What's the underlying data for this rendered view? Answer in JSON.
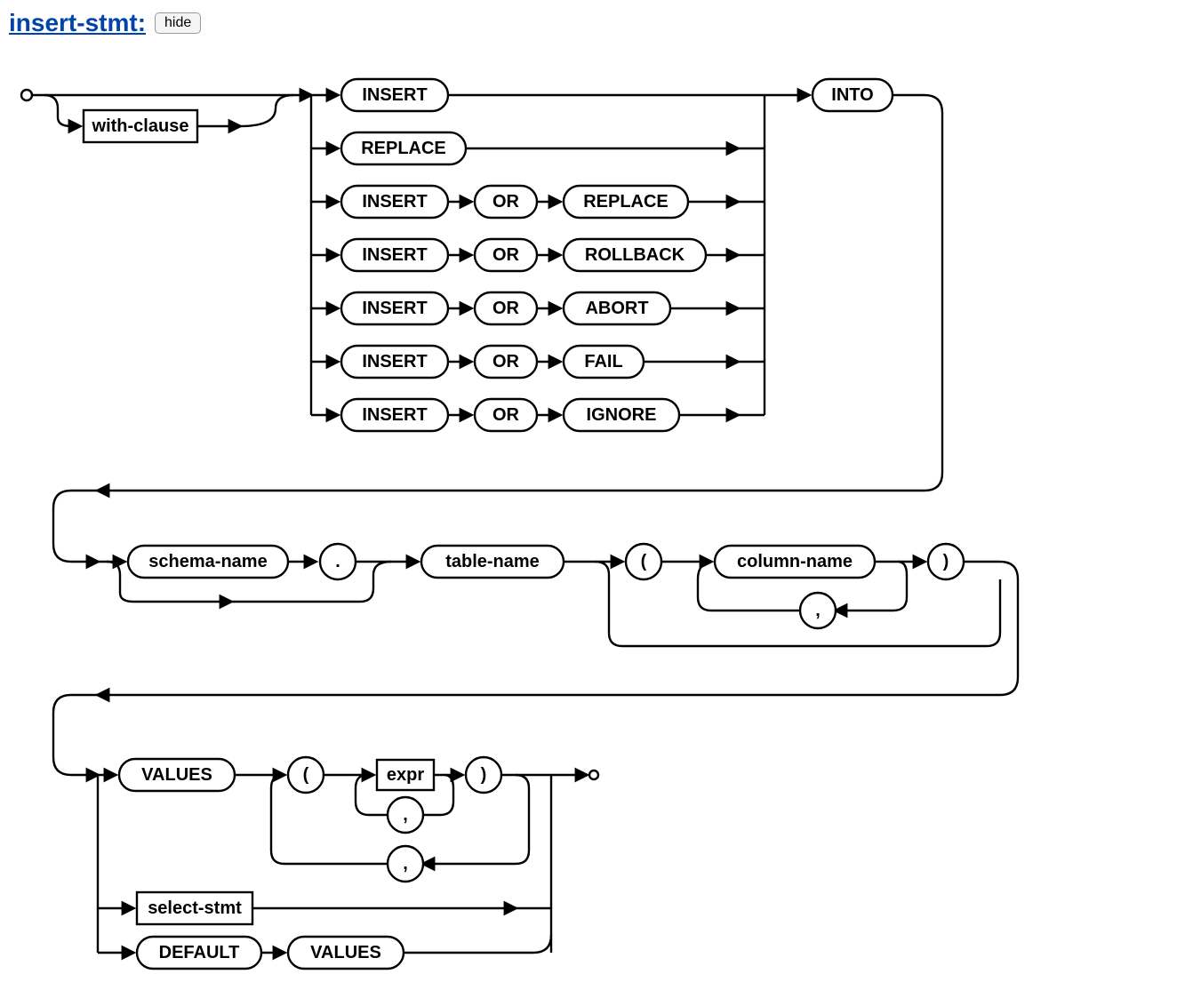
{
  "header": {
    "title": "insert-stmt:",
    "button": "hide"
  },
  "diagram": {
    "with_clause": "with-clause",
    "insert": "INSERT",
    "replace": "REPLACE",
    "or": "OR",
    "rollback": "ROLLBACK",
    "abort": "ABORT",
    "fail": "FAIL",
    "ignore": "IGNORE",
    "into": "INTO",
    "schema_name": "schema-name",
    "dot": ".",
    "table_name": "table-name",
    "lparen": "(",
    "rparen": ")",
    "column_name": "column-name",
    "comma": ",",
    "values": "VALUES",
    "expr": "expr",
    "select_stmt": "select-stmt",
    "default": "DEFAULT"
  }
}
